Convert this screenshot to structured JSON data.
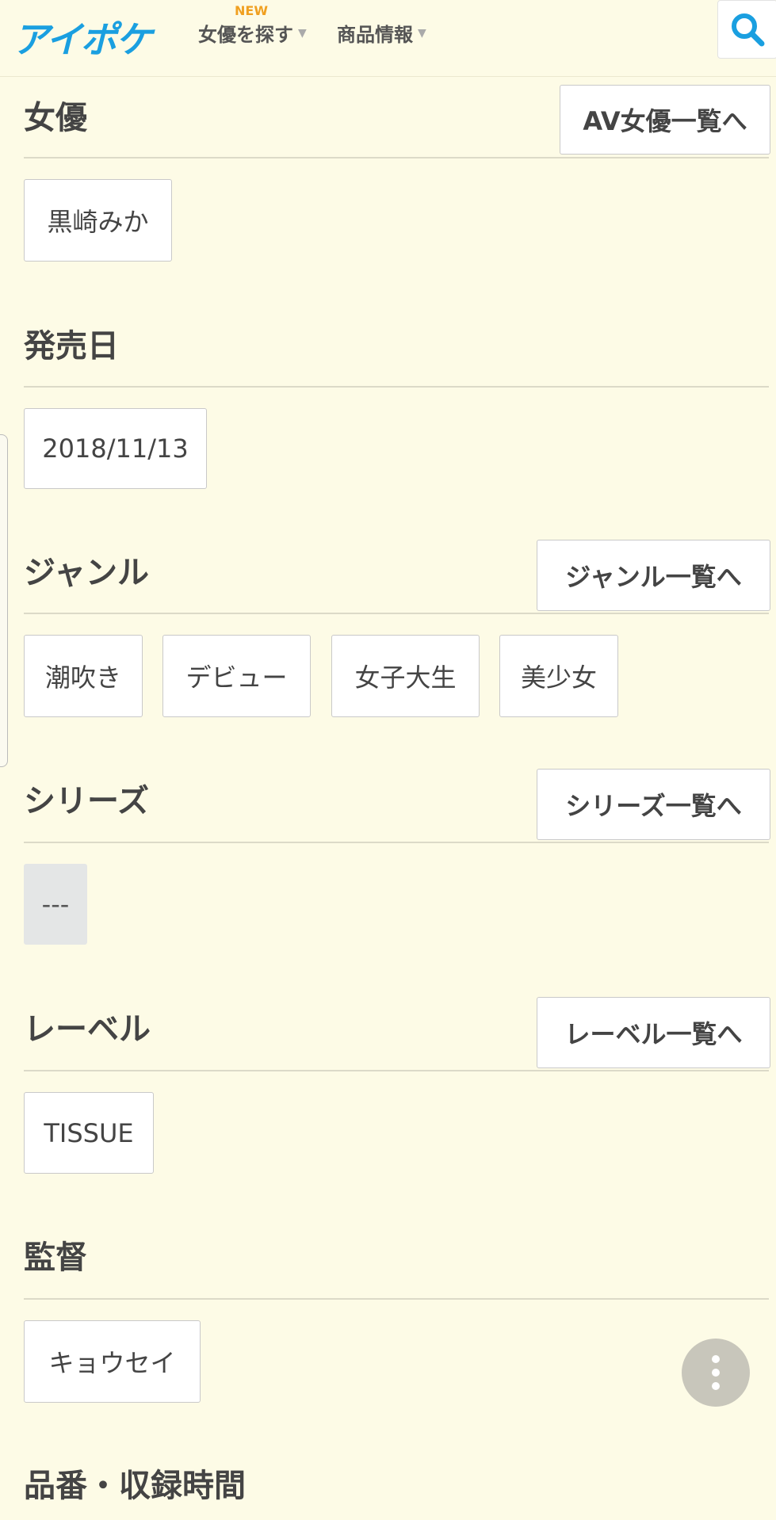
{
  "header": {
    "logo": "アイポケ",
    "new_badge": "NEW",
    "nav": [
      "女優を探す",
      "商品情報"
    ]
  },
  "sections": {
    "actress": {
      "title": "女優",
      "list_button": "AV女優一覧へ",
      "tags": [
        "黒崎みか"
      ]
    },
    "release": {
      "title": "発売日",
      "tags": [
        "2018/11/13"
      ]
    },
    "genre": {
      "title": "ジャンル",
      "list_button": "ジャンル一覧へ",
      "tags": [
        "潮吹き",
        "デビュー",
        "女子大生",
        "美少女"
      ]
    },
    "series": {
      "title": "シリーズ",
      "list_button": "シリーズ一覧へ",
      "tags": [
        "---"
      ]
    },
    "label": {
      "title": "レーベル",
      "list_button": "レーベル一覧へ",
      "tags": [
        "TISSUE"
      ]
    },
    "director": {
      "title": "監督",
      "tags": [
        "キョウセイ"
      ]
    },
    "product": {
      "title": "品番・収録時間"
    }
  },
  "colors": {
    "background": "#fdfbe6",
    "logo": "#1a9fe0",
    "accent": "#f0a020"
  },
  "icons": {
    "search": "search-icon",
    "more": "more-vertical-icon"
  }
}
